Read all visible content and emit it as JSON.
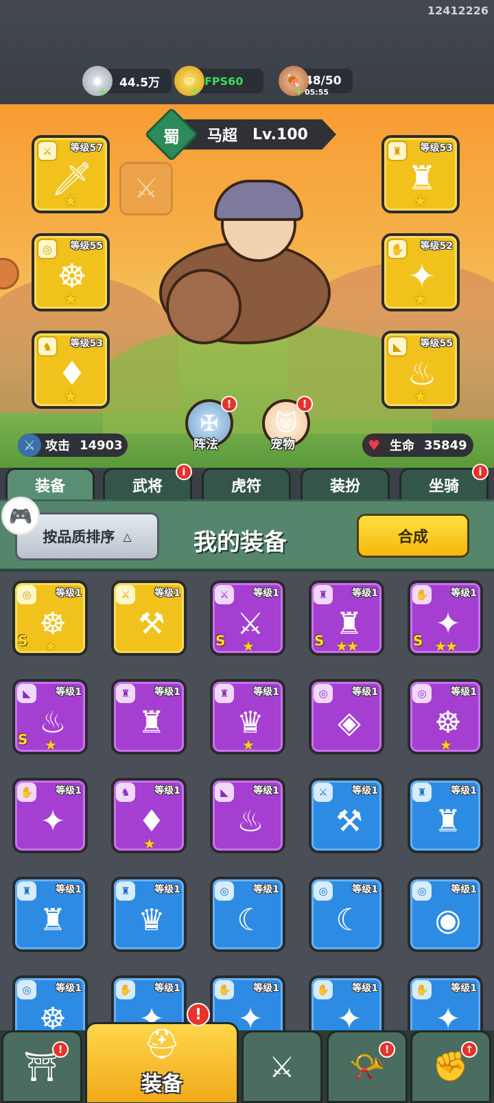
{
  "device_id": "12412226",
  "resources": {
    "silver": {
      "value": "44.5万",
      "icon": "silver-coin-icon"
    },
    "gold": {
      "value": "FPS60",
      "icon": "gold-ingot-icon"
    },
    "food": {
      "value": "48/50",
      "timer": "05:55",
      "icon": "meat-icon"
    }
  },
  "hero": {
    "kingdom": "蜀",
    "name": "马超",
    "level": "Lv.100",
    "slots_left": [
      {
        "level": "等级57",
        "type_icon": "weapon-icon",
        "item": "sword-item"
      },
      {
        "level": "等级55",
        "type_icon": "medal-icon",
        "item": "amulet-item"
      },
      {
        "level": "等级53",
        "type_icon": "helmet-icon",
        "item": "crystal-item"
      }
    ],
    "slots_right": [
      {
        "level": "等级53",
        "type_icon": "armor-icon",
        "item": "armor-item"
      },
      {
        "level": "等级52",
        "type_icon": "bracer-icon",
        "item": "bracer-item"
      },
      {
        "level": "等级55",
        "type_icon": "boots-icon",
        "item": "boots-item"
      }
    ],
    "formation_label": "阵法",
    "pet_label": "宠物",
    "attack_label": "攻击",
    "attack_value": "14903",
    "hp_label": "生命",
    "hp_value": "35849"
  },
  "tabs": [
    "装备",
    "武将",
    "虎符",
    "装扮",
    "坐骑"
  ],
  "panel": {
    "sort_label": "按品质排序",
    "title": "我的装备",
    "merge_label": "合成"
  },
  "inventory": [
    {
      "rarity": "gold",
      "level": "等级1",
      "type": "◎",
      "item": "☸",
      "grade": "S",
      "stars": "★"
    },
    {
      "rarity": "gold",
      "level": "等级1",
      "type": "⚔",
      "item": "⚒",
      "grade": "",
      "stars": ""
    },
    {
      "rarity": "purple",
      "level": "等级1",
      "type": "⚔",
      "item": "⚔",
      "grade": "S",
      "stars": "★"
    },
    {
      "rarity": "purple",
      "level": "等级1",
      "type": "♜",
      "item": "♜",
      "grade": "S",
      "stars": "★★"
    },
    {
      "rarity": "purple",
      "level": "等级1",
      "type": "✋",
      "item": "✦",
      "grade": "S",
      "stars": "★★"
    },
    {
      "rarity": "purple",
      "level": "等级1",
      "type": "◣",
      "item": "♨",
      "grade": "S",
      "stars": "★"
    },
    {
      "rarity": "purple",
      "level": "等级1",
      "type": "♜",
      "item": "♜",
      "grade": "",
      "stars": ""
    },
    {
      "rarity": "purple",
      "level": "等级1",
      "type": "♜",
      "item": "♛",
      "grade": "",
      "stars": "★"
    },
    {
      "rarity": "purple",
      "level": "等级1",
      "type": "◎",
      "item": "◈",
      "grade": "",
      "stars": ""
    },
    {
      "rarity": "purple",
      "level": "等级1",
      "type": "◎",
      "item": "☸",
      "grade": "",
      "stars": "★"
    },
    {
      "rarity": "purple",
      "level": "等级1",
      "type": "✋",
      "item": "✦",
      "grade": "",
      "stars": ""
    },
    {
      "rarity": "purple",
      "level": "等级1",
      "type": "♞",
      "item": "♦",
      "grade": "",
      "stars": "★"
    },
    {
      "rarity": "purple",
      "level": "等级1",
      "type": "◣",
      "item": "♨",
      "grade": "",
      "stars": ""
    },
    {
      "rarity": "blue",
      "level": "等级1",
      "type": "⚔",
      "item": "⚒",
      "grade": "",
      "stars": ""
    },
    {
      "rarity": "blue",
      "level": "等级1",
      "type": "♜",
      "item": "♜",
      "grade": "",
      "stars": ""
    },
    {
      "rarity": "blue",
      "level": "等级1",
      "type": "♜",
      "item": "♜",
      "grade": "",
      "stars": ""
    },
    {
      "rarity": "blue",
      "level": "等级1",
      "type": "♜",
      "item": "♛",
      "grade": "",
      "stars": ""
    },
    {
      "rarity": "blue",
      "level": "等级1",
      "type": "◎",
      "item": "☾",
      "grade": "",
      "stars": ""
    },
    {
      "rarity": "blue",
      "level": "等级1",
      "type": "◎",
      "item": "☾",
      "grade": "",
      "stars": ""
    },
    {
      "rarity": "blue",
      "level": "等级1",
      "type": "◎",
      "item": "◉",
      "grade": "",
      "stars": ""
    },
    {
      "rarity": "blue",
      "level": "等级1",
      "type": "◎",
      "item": "☸",
      "grade": "",
      "stars": ""
    },
    {
      "rarity": "blue",
      "level": "等级1",
      "type": "✋",
      "item": "✦",
      "grade": "",
      "stars": ""
    },
    {
      "rarity": "blue",
      "level": "等级1",
      "type": "✋",
      "item": "✦",
      "grade": "",
      "stars": ""
    },
    {
      "rarity": "blue",
      "level": "等级1",
      "type": "✋",
      "item": "✦",
      "grade": "",
      "stars": ""
    },
    {
      "rarity": "blue",
      "level": "等级1",
      "type": "✋",
      "item": "✦",
      "grade": "",
      "stars": ""
    }
  ],
  "bottom_nav": {
    "active_label": "装备",
    "items": [
      "shop-gate-icon",
      "helmet-icon",
      "crossed-swords-icon",
      "horn-icon",
      "upgrade-fist-icon"
    ]
  },
  "colors": {
    "gold": "#f2c21c",
    "purple": "#a53fd2",
    "blue": "#2e8be4",
    "panel_green": "#55866c"
  }
}
